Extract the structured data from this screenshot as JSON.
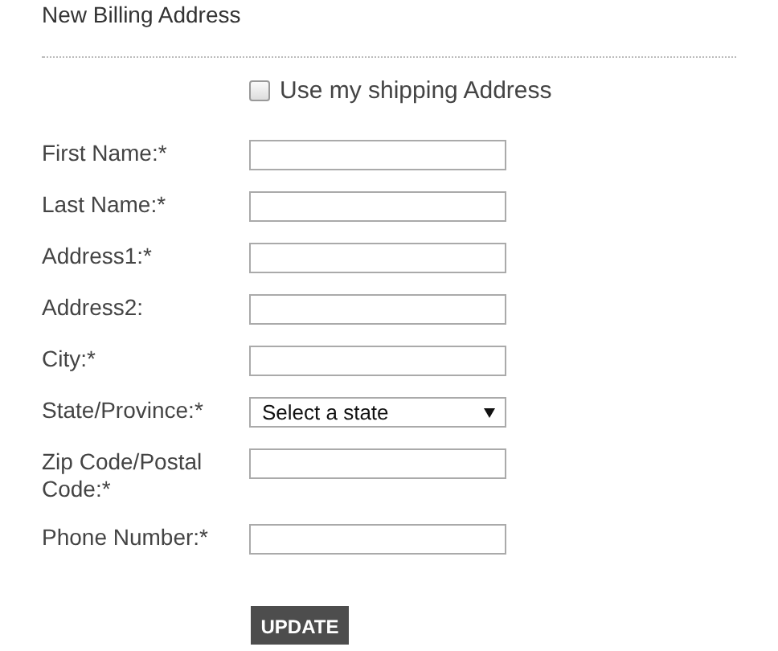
{
  "title": "New Billing Address",
  "use_shipping": {
    "label": "Use my shipping Address",
    "checked": false
  },
  "fields": [
    {
      "kind": "text",
      "label": "First Name:*"
    },
    {
      "kind": "text",
      "label": "Last Name:*"
    },
    {
      "kind": "text",
      "label": "Address1:*"
    },
    {
      "kind": "text",
      "label": "Address2:"
    },
    {
      "kind": "text",
      "label": "City:*"
    },
    {
      "kind": "select",
      "label": "State/Province:*",
      "value": "Select a state"
    },
    {
      "kind": "text",
      "label": "Zip Code/Postal Code:*"
    },
    {
      "kind": "text",
      "label": "Phone Number:*"
    }
  ],
  "button": "UPDATE"
}
